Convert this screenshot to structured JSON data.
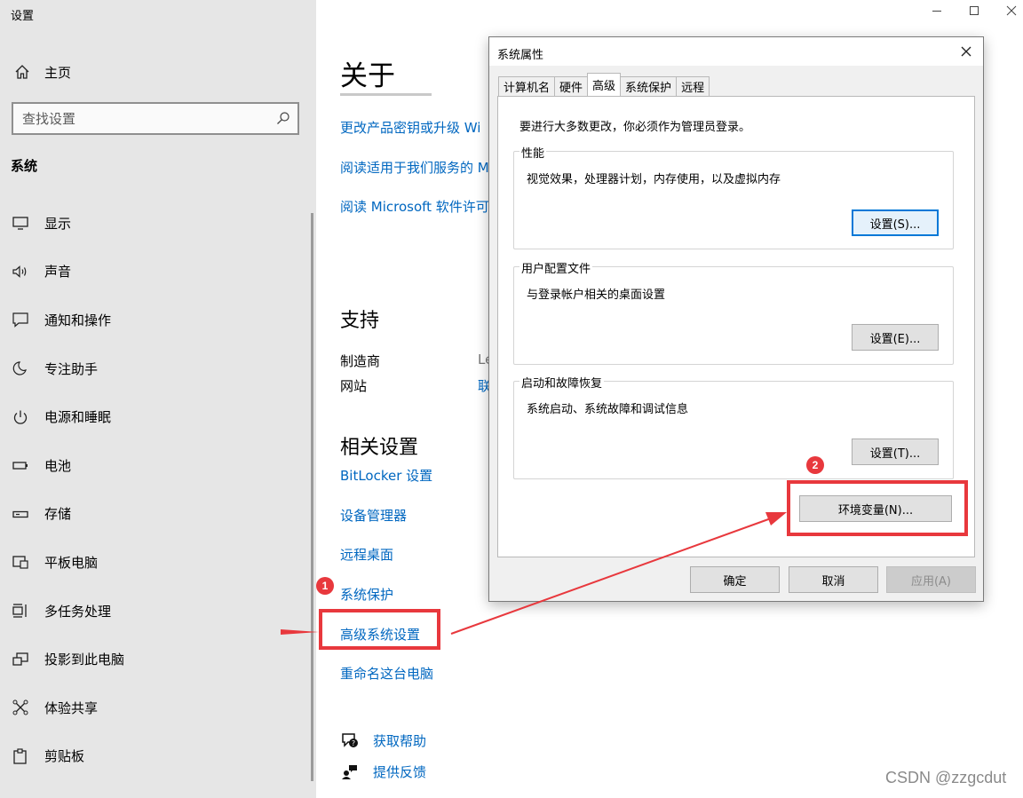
{
  "app": {
    "title": "设置"
  },
  "sidebar": {
    "home_label": "主页",
    "search_placeholder": "查找设置",
    "section_title": "系统",
    "items": [
      {
        "label": "显示",
        "icon": "monitor-icon"
      },
      {
        "label": "声音",
        "icon": "speaker-icon"
      },
      {
        "label": "通知和操作",
        "icon": "notification-icon"
      },
      {
        "label": "专注助手",
        "icon": "moon-icon"
      },
      {
        "label": "电源和睡眠",
        "icon": "power-icon"
      },
      {
        "label": "电池",
        "icon": "battery-icon"
      },
      {
        "label": "存储",
        "icon": "storage-icon"
      },
      {
        "label": "平板电脑",
        "icon": "tablet-icon"
      },
      {
        "label": "多任务处理",
        "icon": "multitask-icon"
      },
      {
        "label": "投影到此电脑",
        "icon": "project-icon"
      },
      {
        "label": "体验共享",
        "icon": "share-icon"
      },
      {
        "label": "剪贴板",
        "icon": "clipboard-icon"
      }
    ]
  },
  "main": {
    "about_title": "关于",
    "about_links": [
      "更改产品密钥或升级 Wi",
      "阅读适用于我们服务的 M",
      "阅读 Microsoft 软件许可"
    ],
    "support_title": "支持",
    "support_rows": [
      {
        "label": "制造商",
        "value": "Le"
      },
      {
        "label": "网站",
        "value": "联"
      }
    ],
    "related_title": "相关设置",
    "related_links": [
      "BitLocker 设置",
      "设备管理器",
      "远程桌面",
      "系统保护",
      "高级系统设置",
      "重命名这台电脑"
    ],
    "help_links": [
      {
        "label": "获取帮助",
        "icon": "help-chat-icon"
      },
      {
        "label": "提供反馈",
        "icon": "feedback-icon"
      }
    ]
  },
  "dialog": {
    "title": "系统属性",
    "tabs": [
      "计算机名",
      "硬件",
      "高级",
      "系统保护",
      "远程"
    ],
    "active_tab": "高级",
    "admin_note": "要进行大多数更改，你必须作为管理员登录。",
    "groups": [
      {
        "title": "性能",
        "desc": "视觉效果，处理器计划，内存使用，以及虚拟内存",
        "button": "设置(S)..."
      },
      {
        "title": "用户配置文件",
        "desc": "与登录帐户相关的桌面设置",
        "button": "设置(E)..."
      },
      {
        "title": "启动和故障恢复",
        "desc": "系统启动、系统故障和调试信息",
        "button": "设置(T)..."
      }
    ],
    "env_button": "环境变量(N)...",
    "ok": "确定",
    "cancel": "取消",
    "apply": "应用(A)"
  },
  "annotations": {
    "badge1": "1",
    "badge2": "2",
    "color": "#e8383d"
  },
  "watermark": "CSDN @zzgcdut",
  "colors": {
    "link": "#0067c0",
    "sidebar_bg": "#e6e6e6",
    "dialog_bg": "#f0f0f0"
  }
}
